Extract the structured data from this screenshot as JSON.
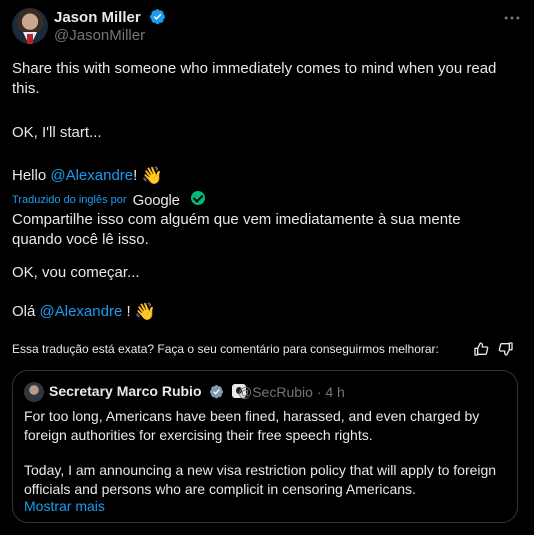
{
  "author": {
    "name": "Jason Miller",
    "handle": "@JasonMiller",
    "verified_color": "#1d9bf0"
  },
  "more_icon": "more-horizontal-icon",
  "tweet": {
    "line1": "Share this with someone who immediately comes to mind when you read this.",
    "line2": "OK, I'll start...",
    "line3_prefix": "Hello ",
    "line3_mention": "@Alexandre",
    "line3_suffix": "!",
    "line3_emoji": "👋"
  },
  "translation": {
    "label": "Traduzido do inglês por",
    "provider": "Google",
    "line1": "Compartilhe isso com alguém que vem imediatamente à sua mente quando você lê isso.",
    "line2": "OK, vou começar...",
    "line3_prefix": "Olá ",
    "line3_mention": "@Alexandre",
    "line3_suffix": " !",
    "line3_emoji": "👋",
    "feedback": "Essa tradução está exata? Faça o seu comentário para conseguirmos melhorar:"
  },
  "quote": {
    "name": "Secretary Marco Rubio",
    "handle": "@SecRubio",
    "separator": "·",
    "time": "4 h",
    "para1": "For too long, Americans have been fined, harassed, and even charged by foreign authorities for exercising their free speech rights.",
    "para2": "Today, I am announcing a new visa restriction policy that will apply to foreign officials and persons who are complicit in censoring Americans.",
    "show_more": "Mostrar mais",
    "verified_color": "#829aab"
  },
  "colors": {
    "background": "#000000",
    "text": "#e7e9ea",
    "secondary": "#71767b",
    "link": "#1d9bf0",
    "border": "#2f3336"
  }
}
